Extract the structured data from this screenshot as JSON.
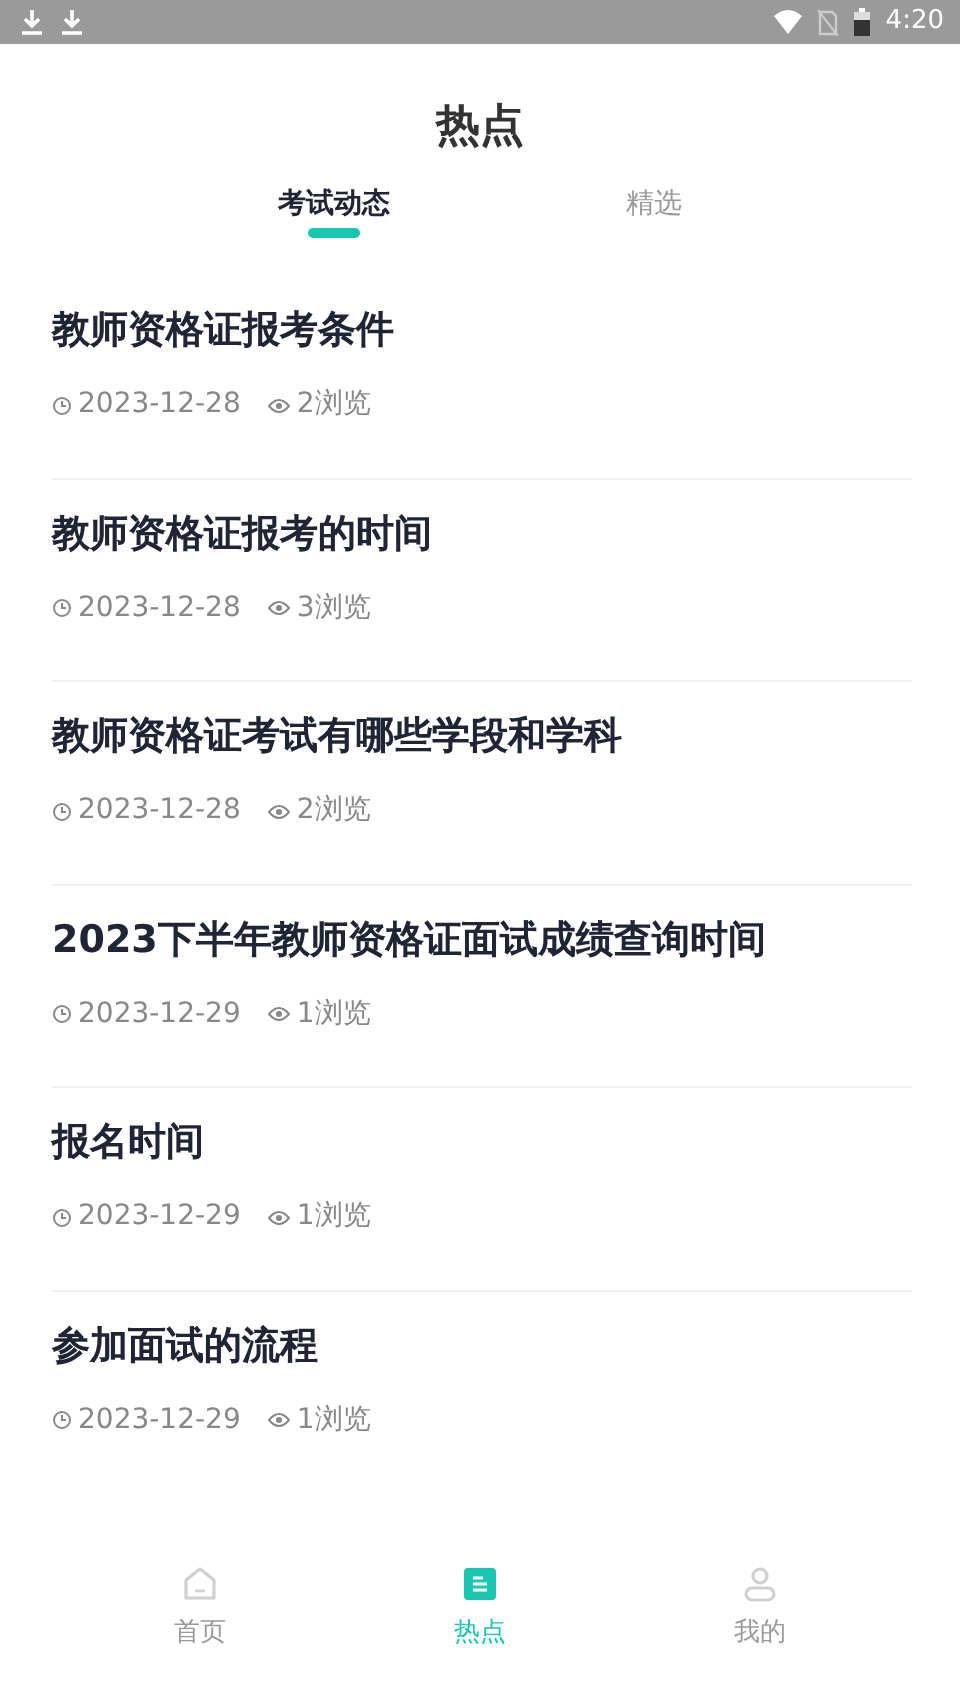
{
  "status_bar": {
    "time": "4:20"
  },
  "title": "热点",
  "tabs": [
    {
      "label": "考试动态",
      "selected": true
    },
    {
      "label": "精选",
      "selected": false
    }
  ],
  "articles": [
    {
      "title": "教师资格证报考条件",
      "date": "2023-12-28",
      "views": "2浏览"
    },
    {
      "title": "教师资格证报考的时间",
      "date": "2023-12-28",
      "views": "3浏览"
    },
    {
      "title": "教师资格证考试有哪些学段和学科",
      "date": "2023-12-28",
      "views": "2浏览"
    },
    {
      "title": "2023下半年教师资格证面试成绩查询时间",
      "date": "2023-12-29",
      "views": "1浏览"
    },
    {
      "title": "报名时间",
      "date": "2023-12-29",
      "views": "1浏览"
    },
    {
      "title": "参加面试的流程",
      "date": "2023-12-29",
      "views": "1浏览"
    }
  ],
  "bottom_nav": [
    {
      "kind": "home",
      "label": "首页",
      "selected": false
    },
    {
      "kind": "news",
      "label": "热点",
      "selected": true
    },
    {
      "kind": "profile",
      "label": "我的",
      "selected": false
    }
  ]
}
